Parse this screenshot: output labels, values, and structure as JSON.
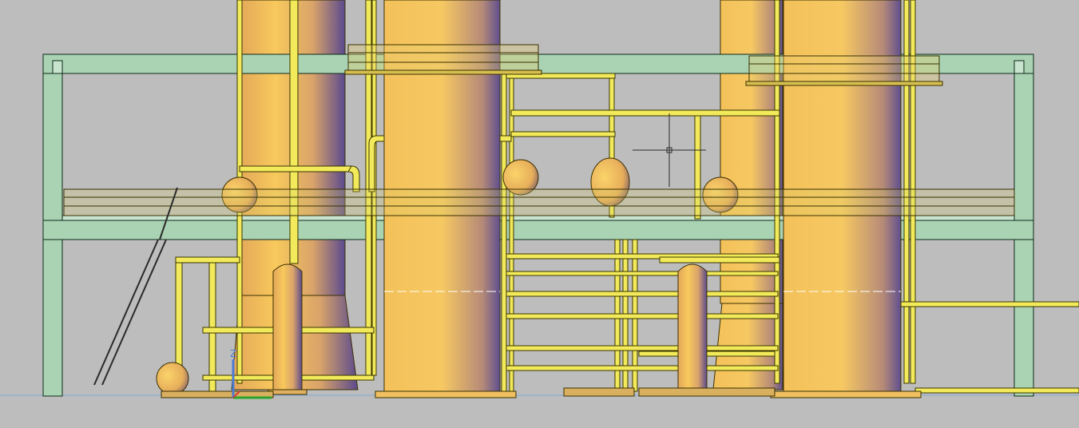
{
  "viewport": {
    "name": "cad-3d-viewport",
    "background": "#bdbdbd",
    "ucs_axes": {
      "z_label": "Z",
      "z_color": "#4a7bd6",
      "x_color": "#2aa52a",
      "y_color": "#d43b3b"
    }
  },
  "colors": {
    "frame_fill": "#a9d3b3",
    "frame_stroke": "#0f2a18",
    "pipe_fill": "#f2ea5a",
    "pipe_stroke": "#3a3500",
    "tank_light": "#f7c65a",
    "tank_mid": "#e0a95a",
    "tank_dark": "#5a4a8a",
    "railing": "#e8d85a"
  },
  "objects": [
    {
      "name": "steel-frame-structure"
    },
    {
      "name": "column-tower-left"
    },
    {
      "name": "column-tower-center"
    },
    {
      "name": "column-tower-right-back"
    },
    {
      "name": "column-tower-right-front"
    },
    {
      "name": "receiver-vessel-left"
    },
    {
      "name": "receiver-vessel-right"
    },
    {
      "name": "walkway-railing"
    },
    {
      "name": "access-ladder"
    }
  ]
}
